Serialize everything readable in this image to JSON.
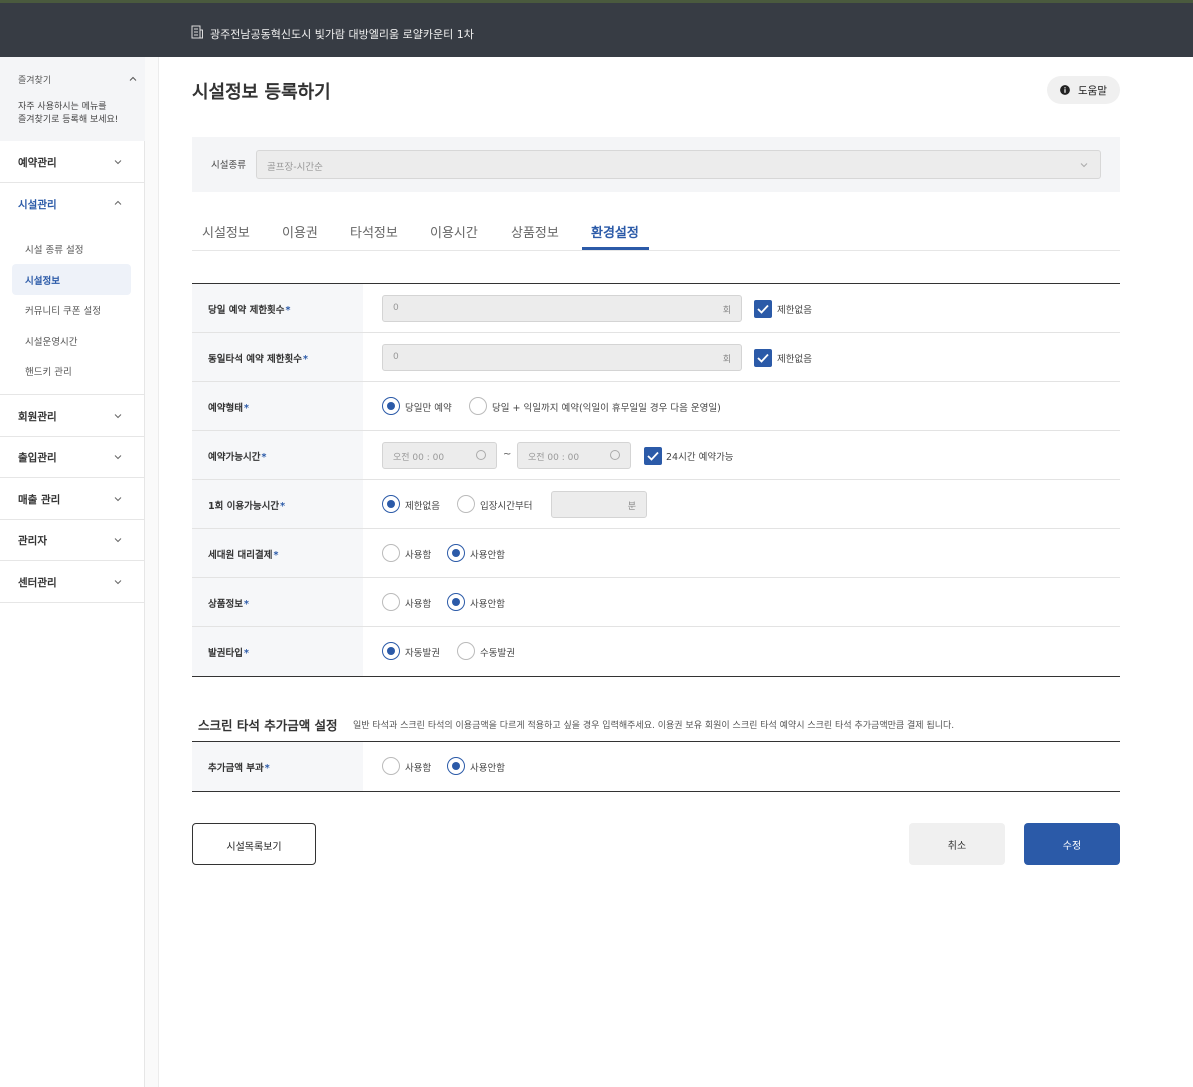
{
  "header": {
    "site_name": "광주전남공동혁신도시 빛가람 대방엘리움 로얄카운티 1차"
  },
  "sidebar": {
    "favorites_title": "즐겨찾기",
    "favorites_desc_1": "자주 사용하시는 메뉴를",
    "favorites_desc_2": "즐겨찾기로 등록해 보세요!",
    "menus": [
      {
        "label": "예약관리"
      },
      {
        "label": "시설관리"
      },
      {
        "label": "회원관리"
      },
      {
        "label": "출입관리"
      },
      {
        "label": "매출 관리"
      },
      {
        "label": "관리자"
      },
      {
        "label": "센터관리"
      }
    ],
    "submenu": [
      {
        "label": "시설 종류 설정"
      },
      {
        "label": "시설정보"
      },
      {
        "label": "커뮤니티 쿠폰 설정"
      },
      {
        "label": "시설운영시간"
      },
      {
        "label": "핸드키 관리"
      }
    ]
  },
  "page": {
    "title": "시설정보 등록하기",
    "help_label": "도움말"
  },
  "facility_type": {
    "label": "시설종류",
    "value": "골프장-시간순"
  },
  "tabs": [
    {
      "label": "시설정보"
    },
    {
      "label": "이용권"
    },
    {
      "label": "타석정보"
    },
    {
      "label": "이용시간"
    },
    {
      "label": "상품정보"
    },
    {
      "label": "환경설정"
    }
  ],
  "required_mark": "*",
  "form": {
    "same_day_limit": {
      "label": "당일 예약 제한횟수",
      "value": "0",
      "unit": "회",
      "check_label": "제한없음",
      "checked": true
    },
    "same_bay_limit": {
      "label": "동일타석 예약 제한횟수",
      "value": "0",
      "unit": "회",
      "check_label": "제한없음",
      "checked": true
    },
    "reservation_type": {
      "label": "예약형태",
      "opt1": "당일만 예약",
      "opt2": "당일 + 익일까지 예약(익일이 휴무일일 경우 다음 운영일)",
      "selected": "opt1"
    },
    "reservable_time": {
      "label": "예약가능시간",
      "from": "오전 00 : 00",
      "tilde": "~",
      "to": "오전 00 : 00",
      "check_label": "24시간 예약가능",
      "checked": true
    },
    "usage_time": {
      "label": "1회 이용가능시간",
      "opt1": "제한없음",
      "opt2": "입장시간부터",
      "unit": "분",
      "selected": "opt1"
    },
    "proxy_payment": {
      "label": "세대원 대리결제",
      "opt1": "사용함",
      "opt2": "사용안함",
      "selected": "opt2"
    },
    "product_info": {
      "label": "상품정보",
      "opt1": "사용함",
      "opt2": "사용안함",
      "selected": "opt2"
    },
    "ticket_type": {
      "label": "발권타입",
      "opt1": "자동발권",
      "opt2": "수동발권",
      "selected": "opt1"
    }
  },
  "screen_section": {
    "title": "스크린 타석 추가금액 설정",
    "desc": "일반 타석과 스크린 타석의 이용금액을 다르게 적용하고 싶을 경우 입력해주세요. 이용권 보유 회원이 스크린 타석 예약시 스크린 타석 추가금액만큼 결제 됩니다.",
    "surcharge": {
      "label": "추가금액 부과",
      "opt1": "사용함",
      "opt2": "사용안함",
      "selected": "opt2"
    }
  },
  "buttons": {
    "list": "시설목록보기",
    "cancel": "취소",
    "save": "수정"
  },
  "colors": {
    "accent": "#2b5aa8",
    "topbar": "#373c44"
  },
  "icons": [
    "building-icon",
    "chevron-up-icon",
    "chevron-down-icon",
    "info-icon",
    "check-icon",
    "clock-icon"
  ]
}
